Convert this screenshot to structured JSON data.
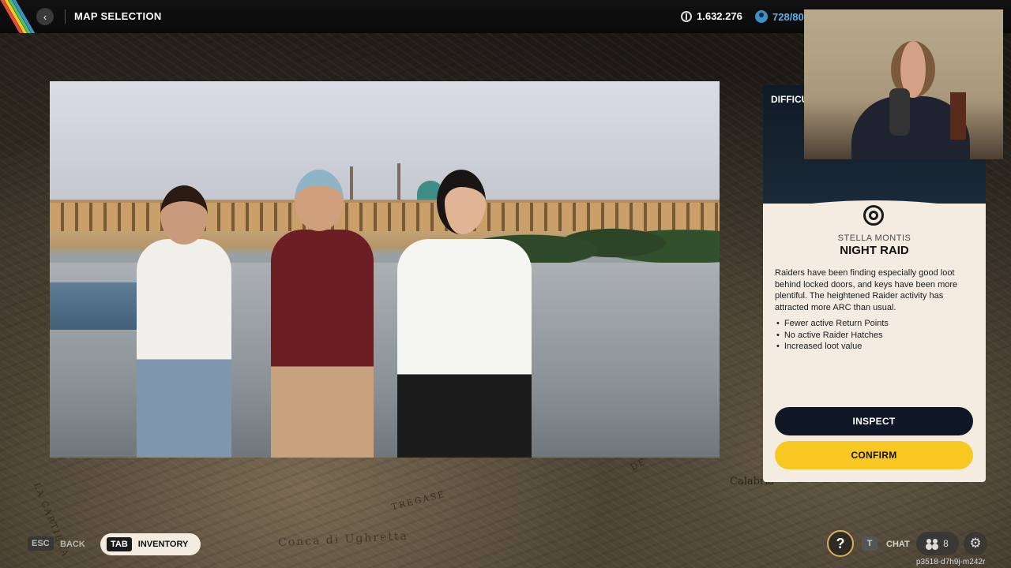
{
  "header": {
    "title": "MAP SELECTION",
    "back_icon": "chevron-left-icon",
    "coins": "1.632.276",
    "tokens": "728/80"
  },
  "map": {
    "labels": [
      "LA CARTIERA",
      "TREGASE",
      "Conca di Ughretta",
      "Calabria",
      "DE"
    ]
  },
  "difficulty": {
    "label": "DIFFICU"
  },
  "event": {
    "map_name": "STELLA MONTIS",
    "name": "NIGHT RAID",
    "description": "Raiders have been finding especially good loot behind locked doors, and keys have been more plentiful. The heightened Raider activity has attracted more ARC than usual.",
    "modifiers": [
      "Fewer active Return Points",
      "No active Raider Hatches",
      "Increased loot value"
    ],
    "inspect_label": "INSPECT",
    "confirm_label": "CONFIRM"
  },
  "footer": {
    "esc_key": "ESC",
    "back_label": "BACK",
    "tab_key": "TAB",
    "inventory_label": "INVENTORY",
    "help_glyph": "?",
    "chat_key": "T",
    "chat_label": "CHAT",
    "party_count": "8",
    "session_id": "p3518-d7h9j-m242r"
  },
  "colors": {
    "accent_yellow": "#f8c822",
    "inspect_dark": "#101828",
    "card_bg": "#f4ece0",
    "tokens_blue": "#3d8fc4"
  }
}
